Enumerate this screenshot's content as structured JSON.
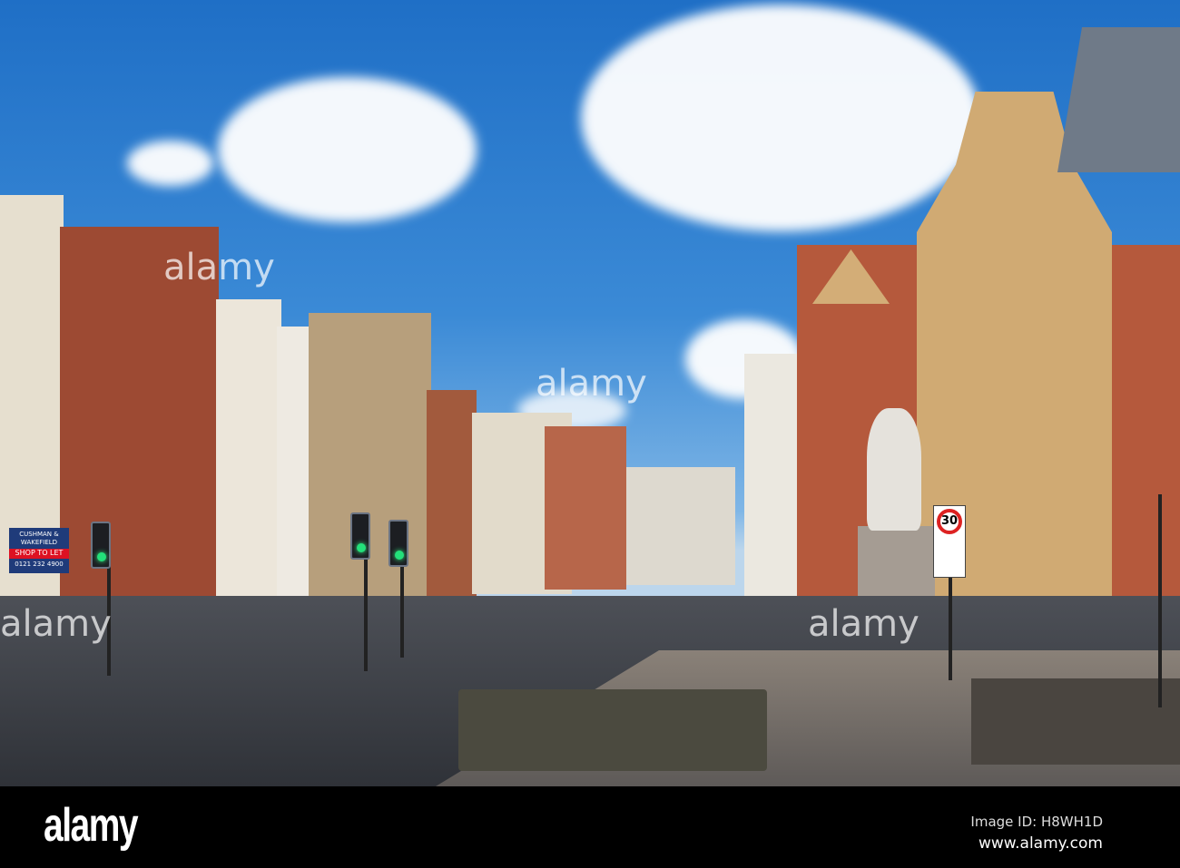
{
  "scene": {
    "description_free": true,
    "signs": {
      "agent_brand": "CUSHMAN & WAKEFIELD",
      "agent_board": "SHOP TO LET",
      "agent_phone": "0121 232 4900",
      "speed_limit": "30"
    }
  },
  "watermark": {
    "logo": "alamy",
    "image_id": "Image ID: H8WH1D",
    "url": "www.alamy.com",
    "overlay": "a"
  }
}
